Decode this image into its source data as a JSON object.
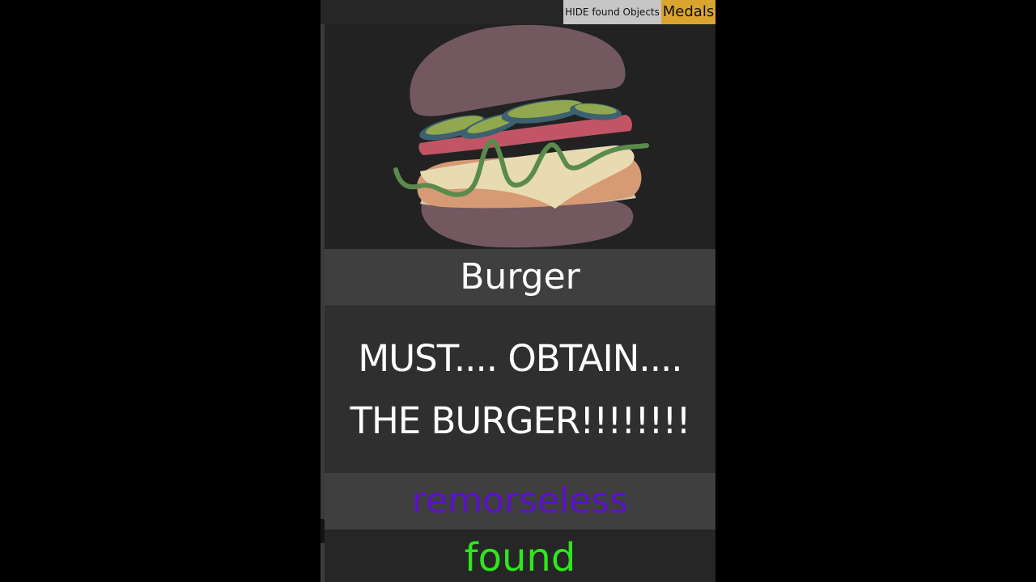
{
  "top_bar": {
    "hide_button_label": "HIDE found Objects",
    "medals_button_label": "Medals"
  },
  "item": {
    "image_icon": "burger-icon",
    "title": "Burger",
    "description": "MUST.... OBTAIN.... THE BURGER!!!!!!!!",
    "difficulty": "remorseless",
    "status": "found"
  },
  "colors": {
    "background": "#000000",
    "panel": "#1f1f1f",
    "hide_button_bg": "#c6c6c6",
    "medals_button_bg": "#d9a52e",
    "difficulty_text": "#5b12c7",
    "status_text": "#2ee61c"
  }
}
